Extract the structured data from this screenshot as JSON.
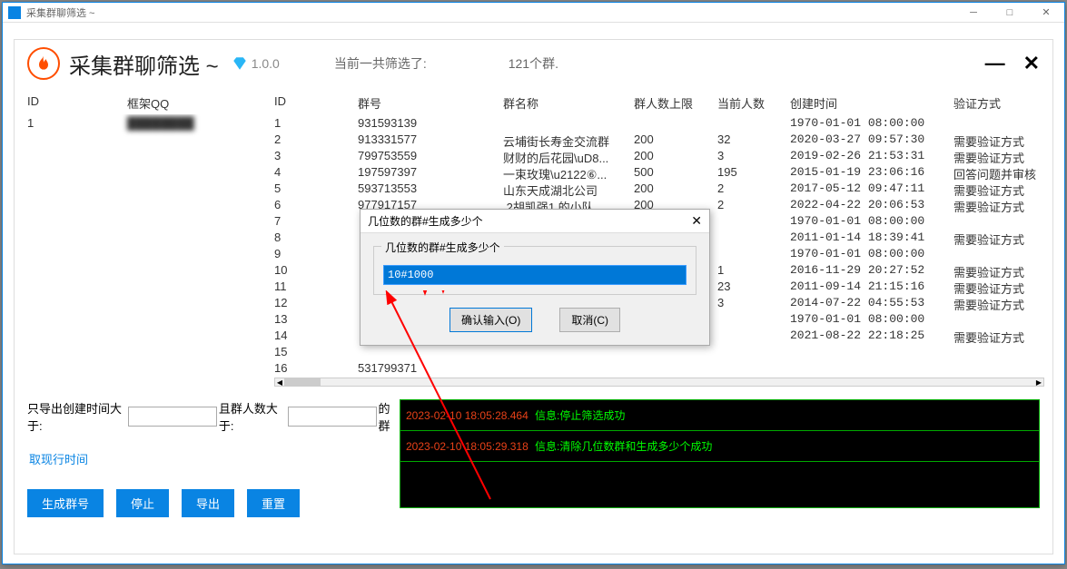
{
  "outer_window": {
    "title": "采集群聊筛选 ~"
  },
  "header": {
    "title": "采集群聊筛选 ~",
    "version": "1.0.0",
    "stat_label": "当前一共筛选了:",
    "stat_value": "121个群."
  },
  "left_table": {
    "headers": [
      "ID",
      "框架QQ"
    ],
    "rows": [
      [
        "1",
        ""
      ]
    ]
  },
  "right_table": {
    "headers": [
      "ID",
      "群号",
      "群名称",
      "群人数上限",
      "当前人数",
      "创建时间",
      "验证方式"
    ],
    "rows": [
      [
        "1",
        "931593139",
        "",
        "",
        "",
        "1970-01-01 08:00:00",
        ""
      ],
      [
        "2",
        "913331577",
        "云埔街长寿金交流群",
        "200",
        "32",
        "2020-03-27 09:57:30",
        "需要验证方式"
      ],
      [
        "3",
        "799753559",
        "财财的后花园\\uD8...",
        "200",
        "3",
        "2019-02-26 21:53:31",
        "需要验证方式"
      ],
      [
        "4",
        "197597397",
        "一束玫瑰\\u2122⑥...",
        "500",
        "195",
        "2015-01-19 23:06:16",
        "回答问题并审核"
      ],
      [
        "5",
        "593713553",
        "山东天成湖北公司",
        "200",
        "2",
        "2017-05-12 09:47:11",
        "需要验证方式"
      ],
      [
        "6",
        "977917157",
        ".2胡凯强1,的小队",
        "200",
        "2",
        "2022-04-22 20:06:53",
        "需要验证方式"
      ],
      [
        "7",
        "",
        "",
        "",
        "",
        "1970-01-01 08:00:00",
        ""
      ],
      [
        "8",
        "",
        "",
        "",
        "",
        "2011-01-14 18:39:41",
        "需要验证方式"
      ],
      [
        "9",
        "",
        "",
        "",
        "",
        "1970-01-01 08:00:00",
        ""
      ],
      [
        "10",
        "",
        "",
        "",
        "1",
        "2016-11-29 20:27:52",
        "需要验证方式"
      ],
      [
        "11",
        "",
        "",
        "",
        "23",
        "2011-09-14 21:15:16",
        "需要验证方式"
      ],
      [
        "12",
        "",
        "",
        "",
        "3",
        "2014-07-22 04:55:53",
        "需要验证方式"
      ],
      [
        "13",
        "",
        "",
        "",
        "",
        "1970-01-01 08:00:00",
        ""
      ],
      [
        "14",
        "",
        "",
        "",
        "",
        "2021-08-22 22:18:25",
        "需要验证方式"
      ],
      [
        "15",
        "",
        "",
        "",
        "",
        "",
        ""
      ],
      [
        "16",
        "531799371",
        "",
        "",
        "",
        "",
        ""
      ]
    ]
  },
  "controls": {
    "filter1_label": "只导出创建时间大于:",
    "filter2_label": "且群人数大于:",
    "filter_suffix": "的群",
    "link": "取现行时间",
    "buttons": [
      "生成群号",
      "停止",
      "导出",
      "重置"
    ]
  },
  "log": [
    {
      "ts": "2023-02-10 18:05:28.464",
      "msg": "信息:停止筛选成功"
    },
    {
      "ts": "2023-02-10 18:05:29.318",
      "msg": "信息:清除几位数群和生成多少个成功"
    }
  ],
  "dialog": {
    "title": "几位数的群#生成多少个",
    "groupbox_label": "几位数的群#生成多少个",
    "input_value": "10#1000",
    "ok": "确认输入(O)",
    "cancel": "取消(C)"
  }
}
